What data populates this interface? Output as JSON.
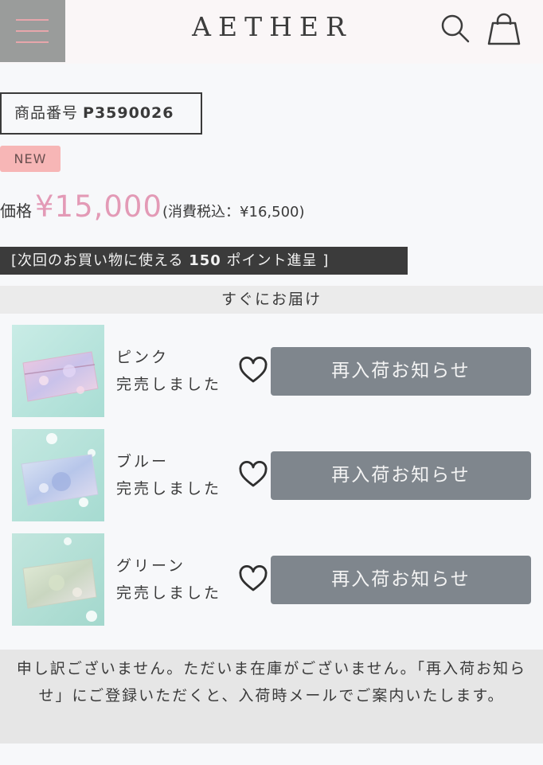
{
  "header": {
    "logo": "AETHER",
    "menu_icon": "hamburger-menu-icon",
    "search_icon": "search-icon",
    "cart_icon": "shopping-bag-icon"
  },
  "product": {
    "number_label": "商品番号",
    "number_value": "P3590026",
    "badge": "NEW",
    "price_label": "価格",
    "price_value": "¥15,000",
    "price_tax": "(消費税込：¥16,500)",
    "points_prefix": "[次回のお買い物に使える ",
    "points_value": "150",
    "points_suffix": " ポイント進呈 ]"
  },
  "delivery": {
    "label": "すぐにお届け"
  },
  "variants": [
    {
      "name": "ピンク",
      "status": "完売しました",
      "button": "再入荷お知らせ",
      "favorite_icon": "heart-outline-icon"
    },
    {
      "name": "ブルー",
      "status": "完売しました",
      "button": "再入荷お知らせ",
      "favorite_icon": "heart-outline-icon"
    },
    {
      "name": "グリーン",
      "status": "完売しました",
      "button": "再入荷お知らせ",
      "favorite_icon": "heart-outline-icon"
    }
  ],
  "notice": {
    "text": "申し訳ございません。ただいま在庫がございません。「再入荷お知らせ」にご登録いただくと、入荷時メールでご案内いたします。"
  },
  "colors": {
    "accent_price": "#e39ab6",
    "badge_bg": "#f7b6b6",
    "button_bg": "#7f868d",
    "points_bg": "#3b3b3b"
  }
}
